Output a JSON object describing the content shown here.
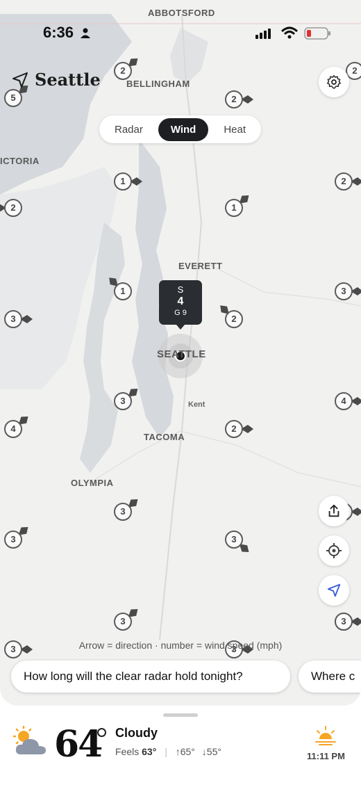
{
  "status_bar": {
    "time": "6:36"
  },
  "header": {
    "city": "Seattle"
  },
  "layer_toggle": {
    "options": [
      "Radar",
      "Wind",
      "Heat"
    ],
    "selected": "Wind"
  },
  "map": {
    "places": [
      {
        "id": "abbotsford",
        "label": "ABBOTSFORD"
      },
      {
        "id": "bellingham",
        "label": "BELLINGHAM"
      },
      {
        "id": "victoria",
        "label": "ICTORIA"
      },
      {
        "id": "everett",
        "label": "EVERETT"
      },
      {
        "id": "seattle",
        "label": "SEATTLE"
      },
      {
        "id": "kent",
        "label": "Kent"
      },
      {
        "id": "tacoma",
        "label": "TACOMA"
      },
      {
        "id": "olympia",
        "label": "OLYMPIA"
      }
    ],
    "wind_markers": [
      {
        "speed": "2",
        "dir": "NE"
      },
      {
        "speed": "5",
        "dir": "NE"
      },
      {
        "speed": "2",
        "dir": "E"
      },
      {
        "speed": "2",
        "dir": "NE"
      },
      {
        "speed": "1",
        "dir": "E"
      },
      {
        "speed": "2",
        "dir": "E"
      },
      {
        "speed": "2",
        "dir": "W"
      },
      {
        "speed": "1",
        "dir": "NE"
      },
      {
        "speed": "1",
        "dir": "NW"
      },
      {
        "speed": "3",
        "dir": "E"
      },
      {
        "speed": "2",
        "dir": "NW"
      },
      {
        "speed": "3",
        "dir": "E"
      },
      {
        "speed": "3",
        "dir": "NE"
      },
      {
        "speed": "4",
        "dir": "NE"
      },
      {
        "speed": "2",
        "dir": "E"
      },
      {
        "speed": "4",
        "dir": "E"
      },
      {
        "speed": "3",
        "dir": "NE"
      },
      {
        "speed": "3",
        "dir": "NE"
      },
      {
        "speed": "3",
        "dir": "SE"
      },
      {
        "speed": "3",
        "dir": "NE"
      },
      {
        "speed": "3",
        "dir": "E"
      },
      {
        "speed": "4",
        "dir": "E"
      },
      {
        "speed": "3",
        "dir": "E"
      },
      {
        "speed": "3",
        "dir": "E"
      },
      {
        "speed": "3",
        "dir": "E"
      }
    ],
    "selected_station": {
      "direction": "S",
      "speed": "4",
      "gust": "G 9"
    },
    "legend": "Arrow = direction · number = wind speed (mph)"
  },
  "suggestions": [
    "How long will the clear radar hold tonight?",
    "Where c"
  ],
  "weather": {
    "temperature": "64",
    "condition": "Cloudy",
    "feels_label": "Feels",
    "feels_value": "63°",
    "high": "↑65°",
    "low": "↓55°",
    "sunset_time": "11:11 PM"
  },
  "colors": {
    "accent": "#f5a623",
    "dark_pill": "#1d1f22",
    "nav_blue": "#3b5bdb"
  }
}
